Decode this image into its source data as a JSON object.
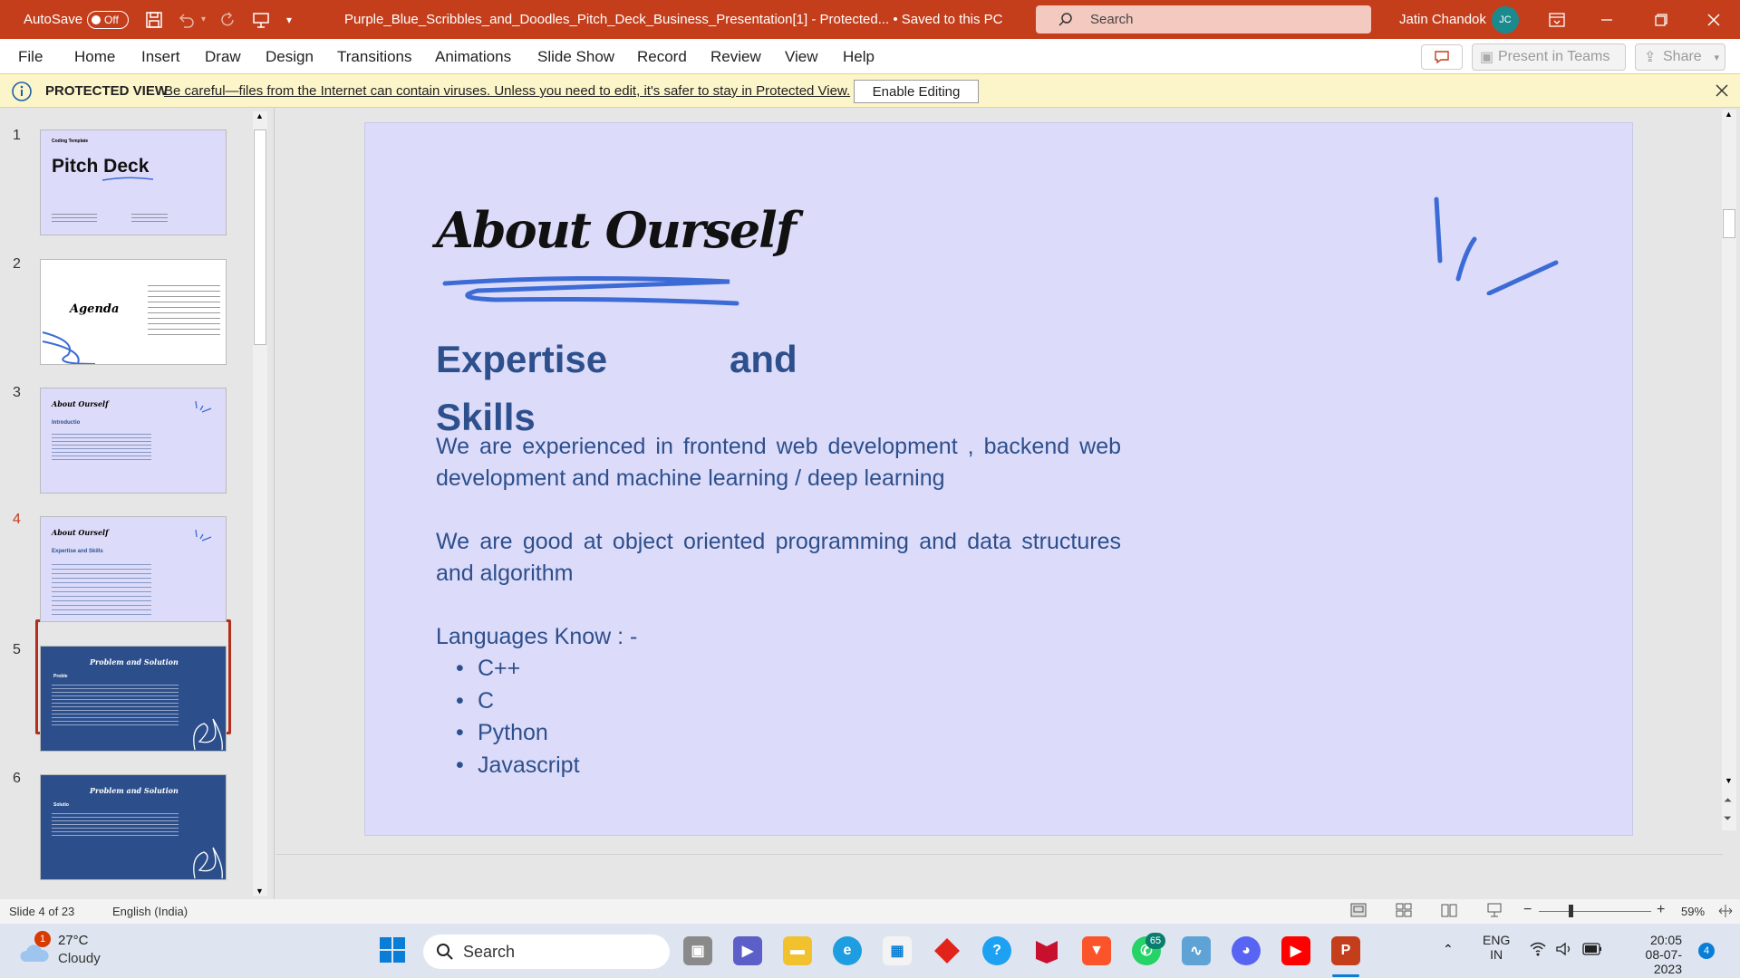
{
  "titlebar": {
    "autosave_label": "AutoSave",
    "autosave_state": "Off",
    "doc_title": "Purple_Blue_Scribbles_and_Doodles_Pitch_Deck_Business_Presentation[1]  -  Protected...  •  Saved to this PC",
    "search_placeholder": "Search",
    "user_name": "Jatin Chandok",
    "user_initials": "JC",
    "accent": "#c43e1c"
  },
  "menu": {
    "tabs": [
      "File",
      "Home",
      "Insert",
      "Draw",
      "Design",
      "Transitions",
      "Animations",
      "Slide Show",
      "Record",
      "Review",
      "View",
      "Help"
    ],
    "present_label": "Present in Teams",
    "share_label": "Share"
  },
  "protected_view": {
    "label": "PROTECTED VIEW",
    "message": "Be careful—files from the Internet can contain viruses. Unless you need to edit, it's safer to stay in Protected View.",
    "button": "Enable Editing"
  },
  "thumbnails": [
    {
      "num": "1",
      "title": "Pitch Deck",
      "caption": "Coding Template"
    },
    {
      "num": "2",
      "title": "Agenda"
    },
    {
      "num": "3",
      "title": "About Ourself",
      "sub": "Introductio"
    },
    {
      "num": "4",
      "title": "About Ourself",
      "sub": "Expertise and Skills"
    },
    {
      "num": "5",
      "title": "Problem and Solution",
      "sub": "Proble"
    },
    {
      "num": "6",
      "title": "Problem and Solution",
      "sub": "Solutio"
    }
  ],
  "slide": {
    "title": "About Ourself",
    "subhead_1": "Expertise",
    "subhead_and": "and",
    "subhead_2": "Skills",
    "para_1": "We are experienced in frontend web development , backend web development and machine learning / deep learning",
    "para_2": "We are good at object oriented programming and data structures and algorithm",
    "languages_heading": "Languages Know : -",
    "languages": [
      "C++",
      "C",
      "Python",
      "Javascript"
    ]
  },
  "status": {
    "slide_info": "Slide 4 of 23",
    "language": "English (India)",
    "zoom": "59%"
  },
  "taskbar": {
    "weather_temp": "27°C",
    "weather_desc": "Cloudy",
    "weather_badge": "1",
    "search_placeholder": "Search",
    "whatsapp_badge": "65",
    "lang_top": "ENG",
    "lang_bottom": "IN",
    "time": "20:05",
    "date": "08-07-2023",
    "notif_count": "4"
  }
}
